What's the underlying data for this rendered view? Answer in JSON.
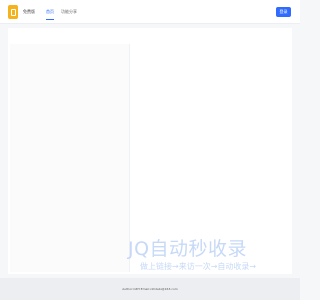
{
  "header": {
    "brand": "免费版",
    "tabs": [
      {
        "label": "首页"
      },
      {
        "label": "功能分享"
      }
    ],
    "login_label": "登录"
  },
  "watermark": {
    "main": "JQ自动秒收录",
    "sub": "做上链接→来访一次→自动收录→"
  },
  "footer": {
    "text": "Author:CZH Email:czhdebi@163.com"
  },
  "colors": {
    "accent": "#2f6bff",
    "logo": "#f6b21a"
  }
}
